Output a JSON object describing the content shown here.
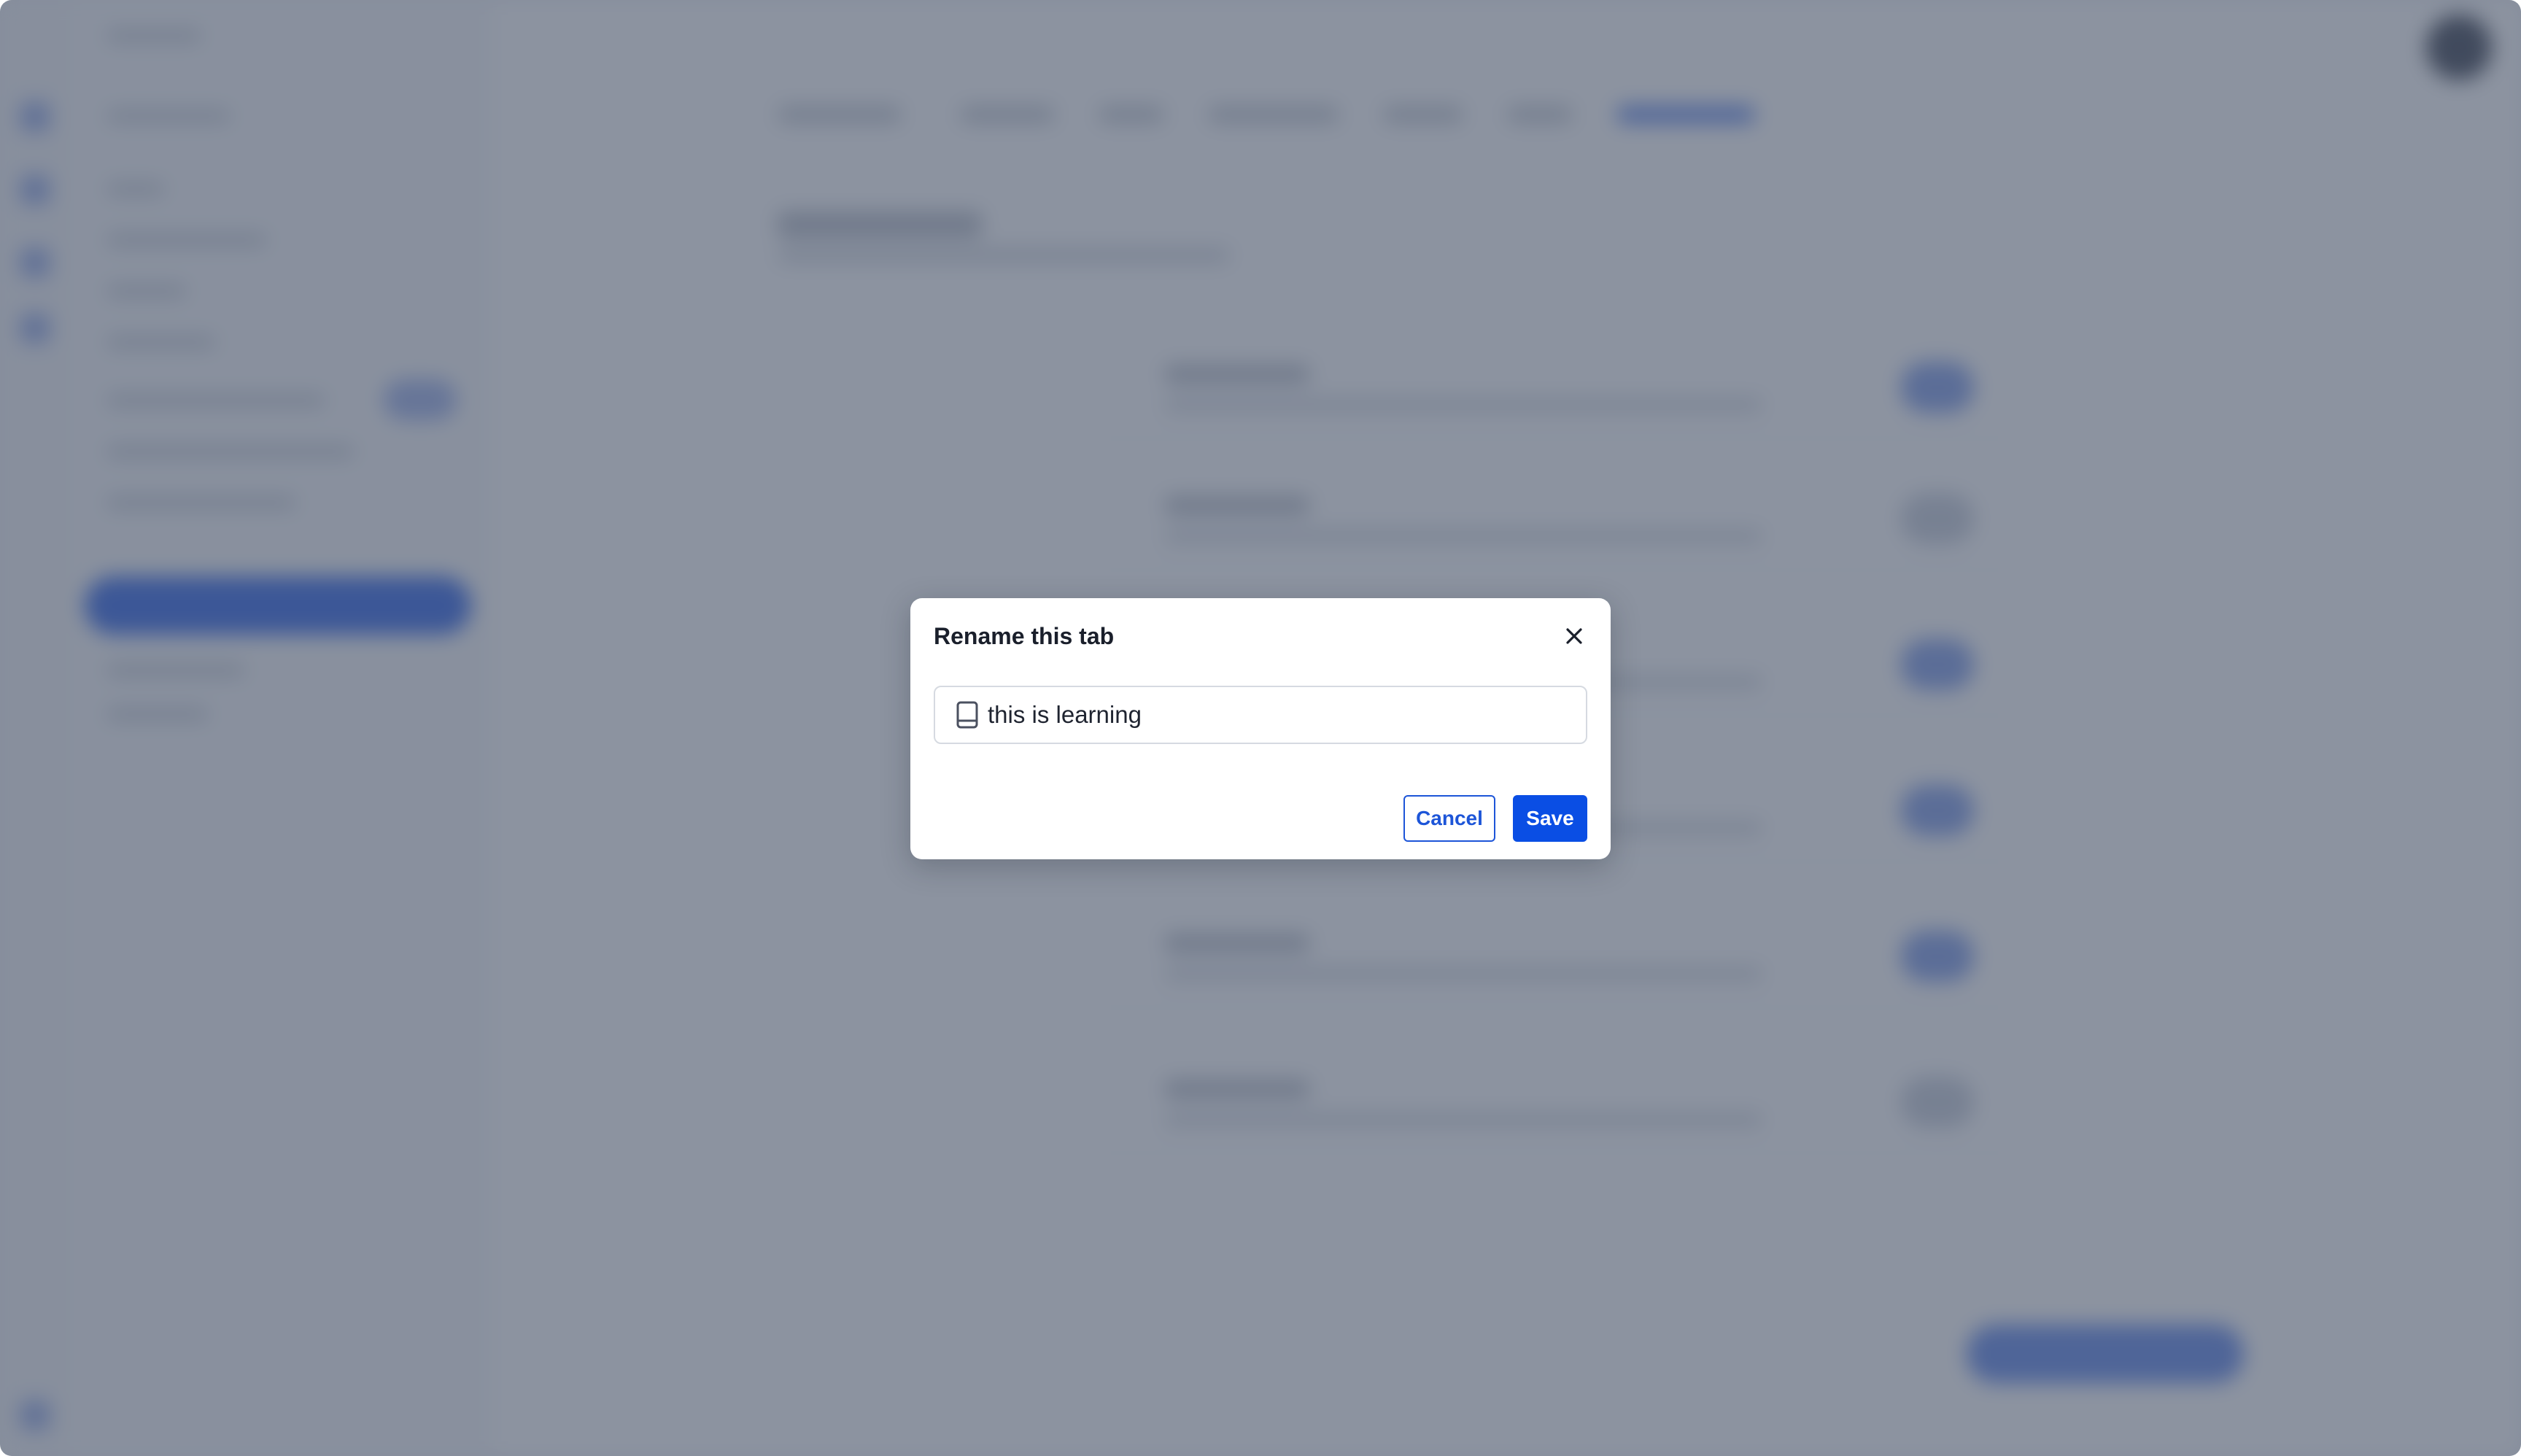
{
  "dialog": {
    "title": "Rename this tab",
    "close_icon": "close-icon",
    "input": {
      "icon": "book-icon",
      "value": "this is learning",
      "placeholder": ""
    },
    "cancel_label": "Cancel",
    "save_label": "Save"
  },
  "colors": {
    "accent": "#0a4ee4",
    "overlay": "rgba(70, 80, 102, 0.62)"
  }
}
